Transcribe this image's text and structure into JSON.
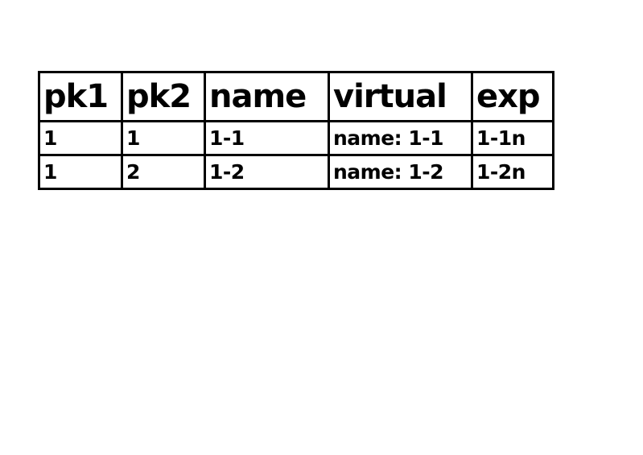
{
  "table": {
    "headers": [
      "pk1",
      "pk2",
      "name",
      "virtual",
      "exp"
    ],
    "rows": [
      [
        "1",
        "1",
        "1-1",
        "name: 1-1",
        "1-1n"
      ],
      [
        "1",
        "2",
        "1-2",
        "name: 1-2",
        "1-2n"
      ]
    ]
  }
}
